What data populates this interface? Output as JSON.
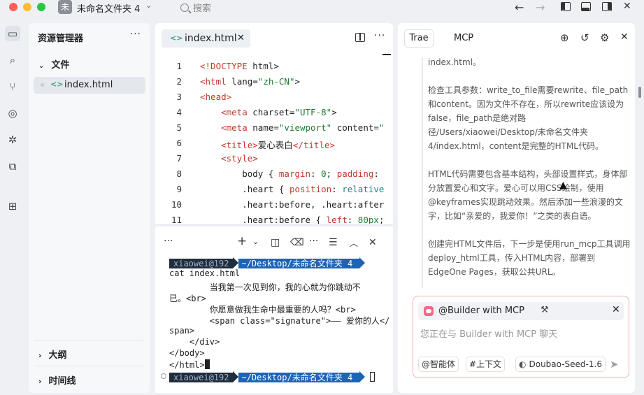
{
  "titlebar": {
    "project_badge": "未",
    "project_name": "未命名文件夹 4",
    "search_label": "搜索"
  },
  "explorer": {
    "title": "资源管理器",
    "folder": "文件",
    "file": "index.html",
    "outline": "大纲",
    "timeline": "时间线"
  },
  "editor": {
    "tab_label": "index.html",
    "lines": [
      {
        "n": "1"
      },
      {
        "n": "2"
      },
      {
        "n": "3"
      },
      {
        "n": "4"
      },
      {
        "n": "5"
      },
      {
        "n": "6"
      },
      {
        "n": "7"
      },
      {
        "n": "8"
      },
      {
        "n": "9"
      },
      {
        "n": "10"
      },
      {
        "n": "11"
      }
    ]
  },
  "terminal": {
    "prompt_user": "xiaowei@192",
    "prompt_path": "~/Desktop/未命名文件夹 4",
    "command": "cat index.html",
    "output": [
      "        当我第一次见到你，我的心就为你跳动不",
      "已。<br>",
      "        你愿意做我生命中最重要的人吗？<br>",
      "        <span class=\"signature\">—— 爱你的人</",
      "span>",
      "    </div>",
      "</body>",
      "</html>"
    ]
  },
  "chat": {
    "tab_trae": "Trae",
    "tab_mcp": "MCP",
    "paragraphs": [
      "index.html。",
      "检查工具参数：write_to_file需要rewrite、file_path和content。因为文件不存在，所以rewrite应该设为false，file_path是绝对路径/Users/xiaowei/Desktop/未命名文件夹 4/index.html，content是完整的HTML代码。",
      "HTML代码需要包含基本结构，头部设置样式，身体部分放置爱心和文字。爱心可以用CSS绘制，使用@keyframes实现跳动效果。然后添加一些浪漫的文字，比如“亲爱的，我爱你！”之类的表白语。",
      "创建完HTML文件后，下一步是使用run_mcp工具调用deploy_html工具，传入HTML内容，部署到EdgeOne Pages，获取公共URL。"
    ],
    "agent_name": "@Builder with MCP",
    "input_placeholder": "您正在与 Builder with MCP 聊天",
    "chip_agent": "@智能体",
    "chip_context": "#上下文",
    "model": "Doubao-Seed-1.6"
  }
}
